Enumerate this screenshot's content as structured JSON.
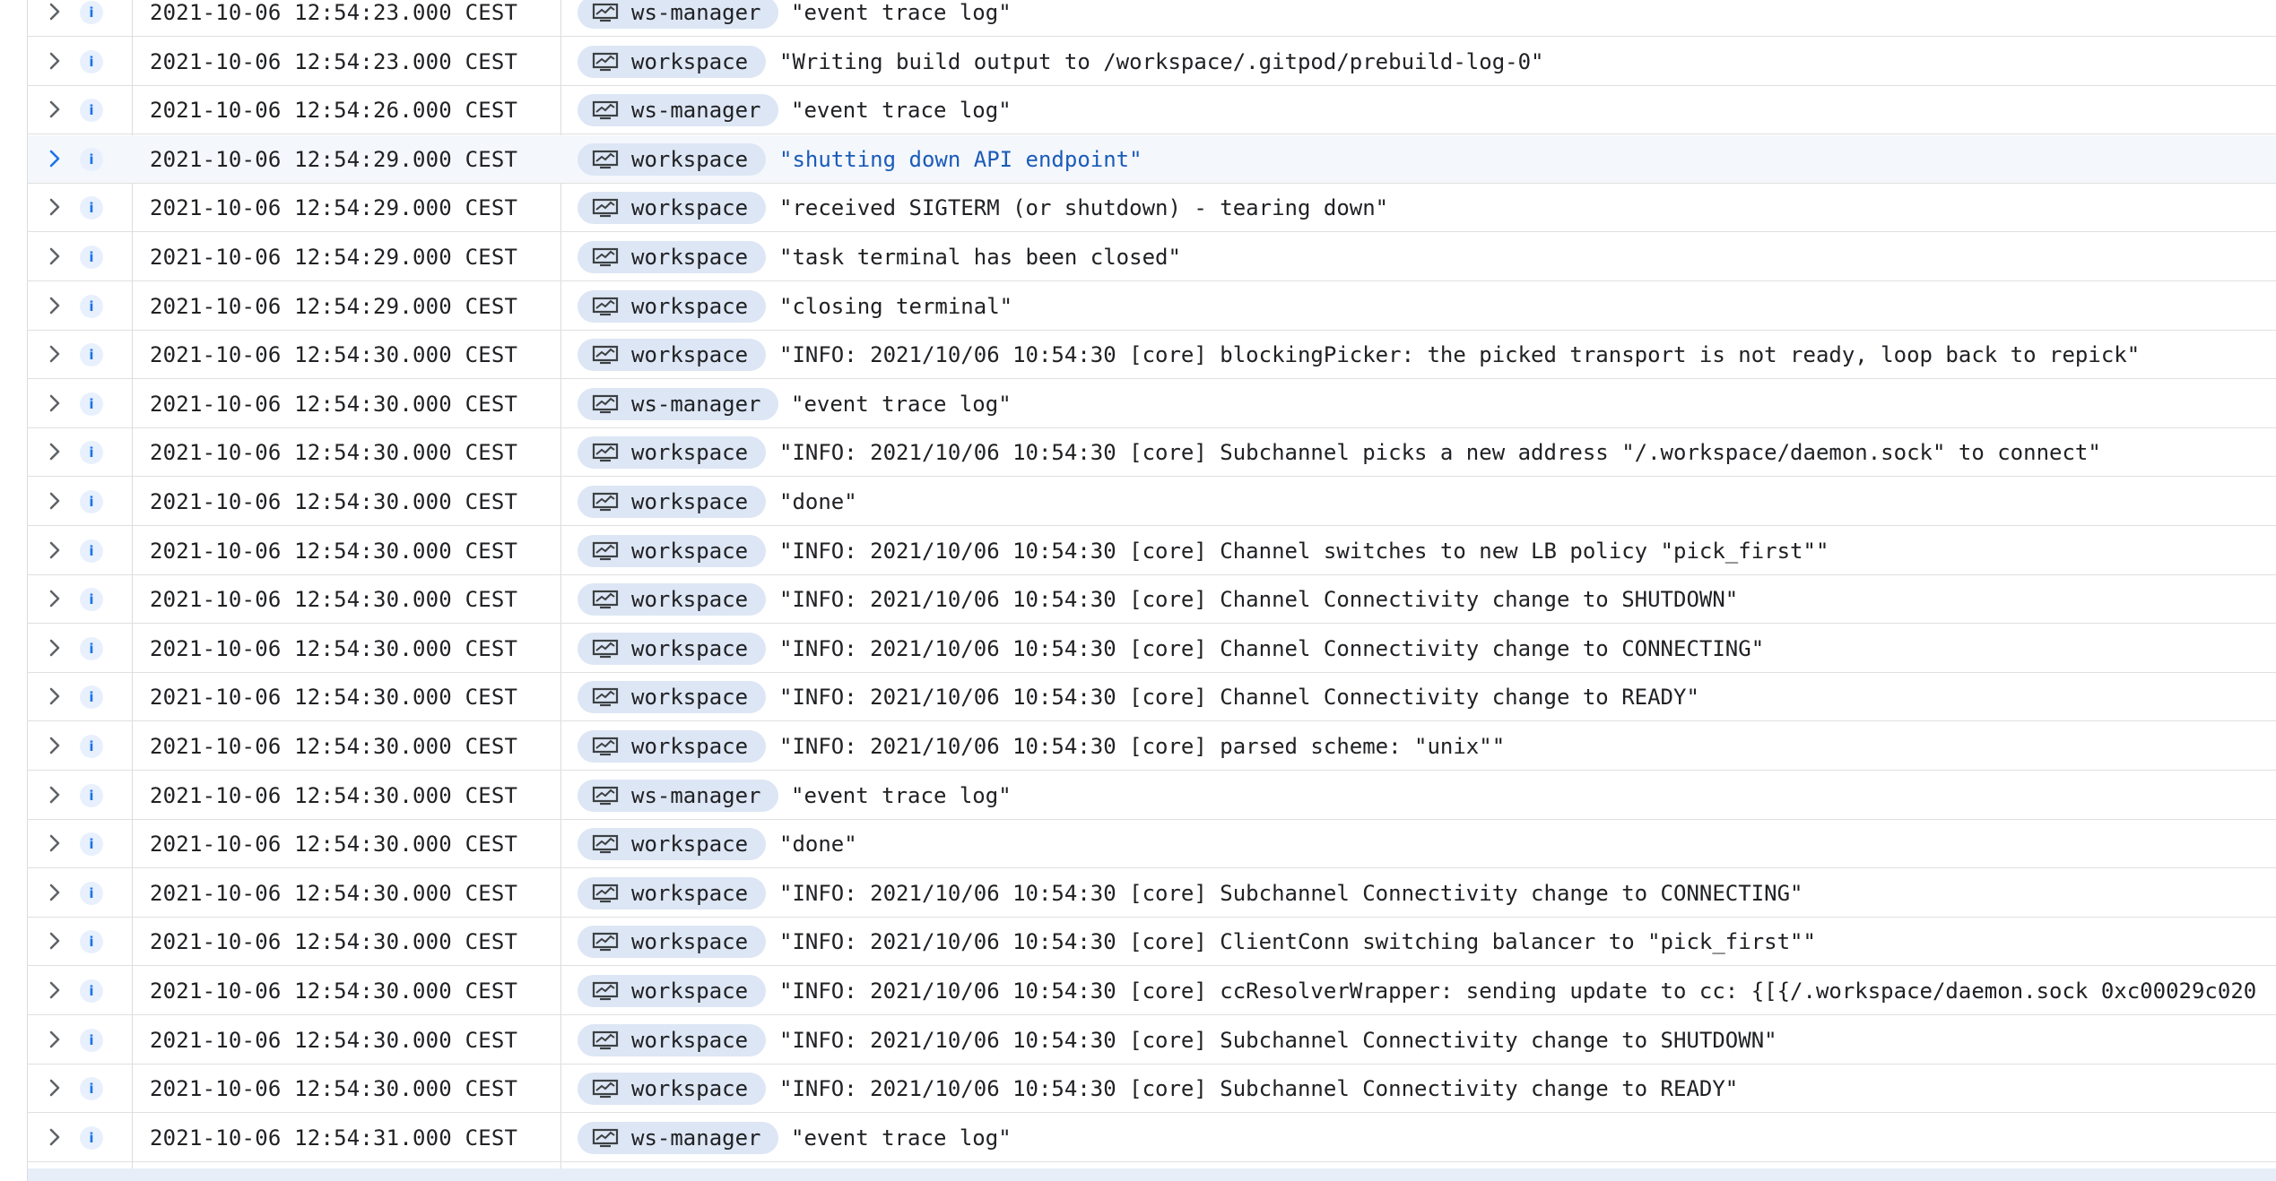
{
  "colors": {
    "accent": "#1a73e8",
    "chip_bg": "#dde6f4",
    "highlight_bg": "#f4f7fc"
  },
  "icons": {
    "expand": "chevron-right-icon",
    "severity": "info-icon",
    "resource": "monitor-icon"
  },
  "rows": [
    {
      "severity": "i",
      "timestamp": "2021-10-06 12:54:23.000 CEST",
      "resource": "ws-manager",
      "message": "\"event trace log\""
    },
    {
      "severity": "i",
      "timestamp": "2021-10-06 12:54:23.000 CEST",
      "resource": "workspace",
      "message": "\"Writing build output to /workspace/.gitpod/prebuild-log-0\""
    },
    {
      "severity": "i",
      "timestamp": "2021-10-06 12:54:26.000 CEST",
      "resource": "ws-manager",
      "message": "\"event trace log\""
    },
    {
      "severity": "i",
      "timestamp": "2021-10-06 12:54:29.000 CEST",
      "resource": "workspace",
      "message": "\"shutting down API endpoint\"",
      "highlight": true
    },
    {
      "severity": "i",
      "timestamp": "2021-10-06 12:54:29.000 CEST",
      "resource": "workspace",
      "message": "\"received SIGTERM (or shutdown) - tearing down\""
    },
    {
      "severity": "i",
      "timestamp": "2021-10-06 12:54:29.000 CEST",
      "resource": "workspace",
      "message": "\"task terminal has been closed\""
    },
    {
      "severity": "i",
      "timestamp": "2021-10-06 12:54:29.000 CEST",
      "resource": "workspace",
      "message": "\"closing terminal\""
    },
    {
      "severity": "i",
      "timestamp": "2021-10-06 12:54:30.000 CEST",
      "resource": "workspace",
      "message": "\"INFO: 2021/10/06 10:54:30 [core] blockingPicker: the picked transport is not ready, loop back to repick\""
    },
    {
      "severity": "i",
      "timestamp": "2021-10-06 12:54:30.000 CEST",
      "resource": "ws-manager",
      "message": "\"event trace log\""
    },
    {
      "severity": "i",
      "timestamp": "2021-10-06 12:54:30.000 CEST",
      "resource": "workspace",
      "message": "\"INFO: 2021/10/06 10:54:30 [core] Subchannel picks a new address \"/.workspace/daemon.sock\" to connect\""
    },
    {
      "severity": "i",
      "timestamp": "2021-10-06 12:54:30.000 CEST",
      "resource": "workspace",
      "message": "\"done\""
    },
    {
      "severity": "i",
      "timestamp": "2021-10-06 12:54:30.000 CEST",
      "resource": "workspace",
      "message": "\"INFO: 2021/10/06 10:54:30 [core] Channel switches to new LB policy \"pick_first\"\""
    },
    {
      "severity": "i",
      "timestamp": "2021-10-06 12:54:30.000 CEST",
      "resource": "workspace",
      "message": "\"INFO: 2021/10/06 10:54:30 [core] Channel Connectivity change to SHUTDOWN\""
    },
    {
      "severity": "i",
      "timestamp": "2021-10-06 12:54:30.000 CEST",
      "resource": "workspace",
      "message": "\"INFO: 2021/10/06 10:54:30 [core] Channel Connectivity change to CONNECTING\""
    },
    {
      "severity": "i",
      "timestamp": "2021-10-06 12:54:30.000 CEST",
      "resource": "workspace",
      "message": "\"INFO: 2021/10/06 10:54:30 [core] Channel Connectivity change to READY\""
    },
    {
      "severity": "i",
      "timestamp": "2021-10-06 12:54:30.000 CEST",
      "resource": "workspace",
      "message": "\"INFO: 2021/10/06 10:54:30 [core] parsed scheme: \"unix\"\""
    },
    {
      "severity": "i",
      "timestamp": "2021-10-06 12:54:30.000 CEST",
      "resource": "ws-manager",
      "message": "\"event trace log\""
    },
    {
      "severity": "i",
      "timestamp": "2021-10-06 12:54:30.000 CEST",
      "resource": "workspace",
      "message": "\"done\""
    },
    {
      "severity": "i",
      "timestamp": "2021-10-06 12:54:30.000 CEST",
      "resource": "workspace",
      "message": "\"INFO: 2021/10/06 10:54:30 [core] Subchannel Connectivity change to CONNECTING\""
    },
    {
      "severity": "i",
      "timestamp": "2021-10-06 12:54:30.000 CEST",
      "resource": "workspace",
      "message": "\"INFO: 2021/10/06 10:54:30 [core] ClientConn switching balancer to \"pick_first\"\""
    },
    {
      "severity": "i",
      "timestamp": "2021-10-06 12:54:30.000 CEST",
      "resource": "workspace",
      "message": "\"INFO: 2021/10/06 10:54:30 [core] ccResolverWrapper: sending update to cc: {[{/.workspace/daemon.sock 0xc00029c020"
    },
    {
      "severity": "i",
      "timestamp": "2021-10-06 12:54:30.000 CEST",
      "resource": "workspace",
      "message": "\"INFO: 2021/10/06 10:54:30 [core] Subchannel Connectivity change to SHUTDOWN\""
    },
    {
      "severity": "i",
      "timestamp": "2021-10-06 12:54:30.000 CEST",
      "resource": "workspace",
      "message": "\"INFO: 2021/10/06 10:54:30 [core] Subchannel Connectivity change to READY\""
    },
    {
      "severity": "i",
      "timestamp": "2021-10-06 12:54:31.000 CEST",
      "resource": "ws-manager",
      "message": "\"event trace log\""
    }
  ]
}
